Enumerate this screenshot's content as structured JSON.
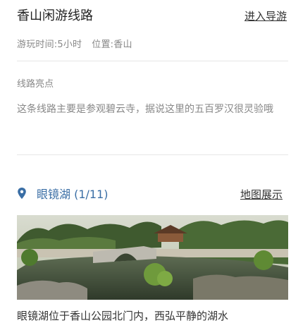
{
  "route": {
    "title": "香山闲游线路",
    "guide_link": "进入导游",
    "duration": "游玩时间:5小时",
    "location": "位置:香山"
  },
  "highlights": {
    "label": "线路亮点",
    "description": "这条线路主要是参观碧云寺，据说这里的五百罗汉很灵验哦"
  },
  "stop": {
    "icon": "location-pin-icon",
    "name": "眼镜湖 (1/11)",
    "map_link": "地图展示",
    "description": "眼镜湖位于香山公园北门内，西弘平静的湖水"
  },
  "colors": {
    "accent": "#3a6ea5",
    "muted": "#888888",
    "text": "#222222"
  }
}
